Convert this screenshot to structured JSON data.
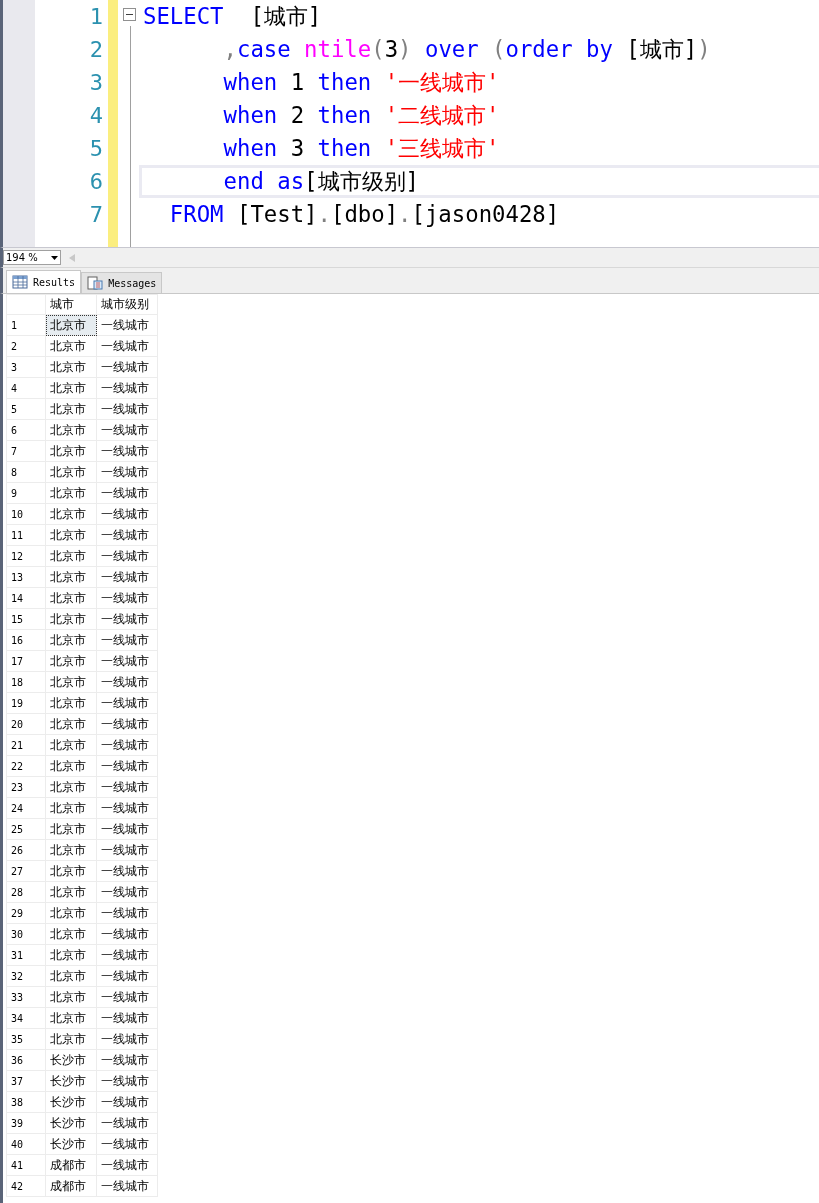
{
  "editor": {
    "lines": [
      {
        "number": "1",
        "current": false,
        "tokens": [
          {
            "kind": "keyword",
            "text": "SELECT  "
          },
          {
            "kind": "plain",
            "text": "[城市]"
          }
        ]
      },
      {
        "number": "2",
        "current": false,
        "tokens": [
          {
            "kind": "punct",
            "text": "      ,"
          },
          {
            "kind": "keyword",
            "text": "case "
          },
          {
            "kind": "function",
            "text": "ntile"
          },
          {
            "kind": "punct",
            "text": "("
          },
          {
            "kind": "plain",
            "text": "3"
          },
          {
            "kind": "punct",
            "text": ") "
          },
          {
            "kind": "keyword",
            "text": "over "
          },
          {
            "kind": "punct",
            "text": "("
          },
          {
            "kind": "keyword",
            "text": "order by "
          },
          {
            "kind": "plain",
            "text": "[城市]"
          },
          {
            "kind": "punct",
            "text": ")"
          }
        ]
      },
      {
        "number": "3",
        "current": false,
        "tokens": [
          {
            "kind": "keyword",
            "text": "      when "
          },
          {
            "kind": "plain",
            "text": "1 "
          },
          {
            "kind": "keyword",
            "text": "then "
          },
          {
            "kind": "string",
            "text": "'一线城市'"
          }
        ]
      },
      {
        "number": "4",
        "current": false,
        "tokens": [
          {
            "kind": "keyword",
            "text": "      when "
          },
          {
            "kind": "plain",
            "text": "2 "
          },
          {
            "kind": "keyword",
            "text": "then "
          },
          {
            "kind": "string",
            "text": "'二线城市'"
          }
        ]
      },
      {
        "number": "5",
        "current": false,
        "tokens": [
          {
            "kind": "keyword",
            "text": "      when "
          },
          {
            "kind": "plain",
            "text": "3 "
          },
          {
            "kind": "keyword",
            "text": "then "
          },
          {
            "kind": "string",
            "text": "'三线城市'"
          }
        ]
      },
      {
        "number": "6",
        "current": true,
        "tokens": [
          {
            "kind": "keyword",
            "text": "      end as"
          },
          {
            "kind": "plain",
            "text": "[城市级别]"
          }
        ]
      },
      {
        "number": "7",
        "current": false,
        "tokens": [
          {
            "kind": "keyword",
            "text": "  FROM "
          },
          {
            "kind": "plain",
            "text": "[Test]"
          },
          {
            "kind": "punct",
            "text": "."
          },
          {
            "kind": "plain",
            "text": "[dbo]"
          },
          {
            "kind": "punct",
            "text": "."
          },
          {
            "kind": "plain",
            "text": "[jason0428]"
          }
        ]
      }
    ]
  },
  "zoom": {
    "value": "194 %"
  },
  "tabs": [
    {
      "label": "Results",
      "selected": true
    },
    {
      "label": "Messages",
      "selected": false
    }
  ],
  "table": {
    "columns": [
      "城市",
      "城市级别"
    ],
    "rows": [
      {
        "number": "1",
        "city": "北京市",
        "tier": "一线城市",
        "selected": true
      },
      {
        "number": "2",
        "city": "北京市",
        "tier": "一线城市",
        "selected": false
      },
      {
        "number": "3",
        "city": "北京市",
        "tier": "一线城市",
        "selected": false
      },
      {
        "number": "4",
        "city": "北京市",
        "tier": "一线城市",
        "selected": false
      },
      {
        "number": "5",
        "city": "北京市",
        "tier": "一线城市",
        "selected": false
      },
      {
        "number": "6",
        "city": "北京市",
        "tier": "一线城市",
        "selected": false
      },
      {
        "number": "7",
        "city": "北京市",
        "tier": "一线城市",
        "selected": false
      },
      {
        "number": "8",
        "city": "北京市",
        "tier": "一线城市",
        "selected": false
      },
      {
        "number": "9",
        "city": "北京市",
        "tier": "一线城市",
        "selected": false
      },
      {
        "number": "10",
        "city": "北京市",
        "tier": "一线城市",
        "selected": false
      },
      {
        "number": "11",
        "city": "北京市",
        "tier": "一线城市",
        "selected": false
      },
      {
        "number": "12",
        "city": "北京市",
        "tier": "一线城市",
        "selected": false
      },
      {
        "number": "13",
        "city": "北京市",
        "tier": "一线城市",
        "selected": false
      },
      {
        "number": "14",
        "city": "北京市",
        "tier": "一线城市",
        "selected": false
      },
      {
        "number": "15",
        "city": "北京市",
        "tier": "一线城市",
        "selected": false
      },
      {
        "number": "16",
        "city": "北京市",
        "tier": "一线城市",
        "selected": false
      },
      {
        "number": "17",
        "city": "北京市",
        "tier": "一线城市",
        "selected": false
      },
      {
        "number": "18",
        "city": "北京市",
        "tier": "一线城市",
        "selected": false
      },
      {
        "number": "19",
        "city": "北京市",
        "tier": "一线城市",
        "selected": false
      },
      {
        "number": "20",
        "city": "北京市",
        "tier": "一线城市",
        "selected": false
      },
      {
        "number": "21",
        "city": "北京市",
        "tier": "一线城市",
        "selected": false
      },
      {
        "number": "22",
        "city": "北京市",
        "tier": "一线城市",
        "selected": false
      },
      {
        "number": "23",
        "city": "北京市",
        "tier": "一线城市",
        "selected": false
      },
      {
        "number": "24",
        "city": "北京市",
        "tier": "一线城市",
        "selected": false
      },
      {
        "number": "25",
        "city": "北京市",
        "tier": "一线城市",
        "selected": false
      },
      {
        "number": "26",
        "city": "北京市",
        "tier": "一线城市",
        "selected": false
      },
      {
        "number": "27",
        "city": "北京市",
        "tier": "一线城市",
        "selected": false
      },
      {
        "number": "28",
        "city": "北京市",
        "tier": "一线城市",
        "selected": false
      },
      {
        "number": "29",
        "city": "北京市",
        "tier": "一线城市",
        "selected": false
      },
      {
        "number": "30",
        "city": "北京市",
        "tier": "一线城市",
        "selected": false
      },
      {
        "number": "31",
        "city": "北京市",
        "tier": "一线城市",
        "selected": false
      },
      {
        "number": "32",
        "city": "北京市",
        "tier": "一线城市",
        "selected": false
      },
      {
        "number": "33",
        "city": "北京市",
        "tier": "一线城市",
        "selected": false
      },
      {
        "number": "34",
        "city": "北京市",
        "tier": "一线城市",
        "selected": false
      },
      {
        "number": "35",
        "city": "北京市",
        "tier": "一线城市",
        "selected": false
      },
      {
        "number": "36",
        "city": "长沙市",
        "tier": "一线城市",
        "selected": false
      },
      {
        "number": "37",
        "city": "长沙市",
        "tier": "一线城市",
        "selected": false
      },
      {
        "number": "38",
        "city": "长沙市",
        "tier": "一线城市",
        "selected": false
      },
      {
        "number": "39",
        "city": "长沙市",
        "tier": "一线城市",
        "selected": false
      },
      {
        "number": "40",
        "city": "长沙市",
        "tier": "一线城市",
        "selected": false
      },
      {
        "number": "41",
        "city": "成都市",
        "tier": "一线城市",
        "selected": false
      },
      {
        "number": "42",
        "city": "成都市",
        "tier": "一线城市",
        "selected": false
      }
    ]
  }
}
